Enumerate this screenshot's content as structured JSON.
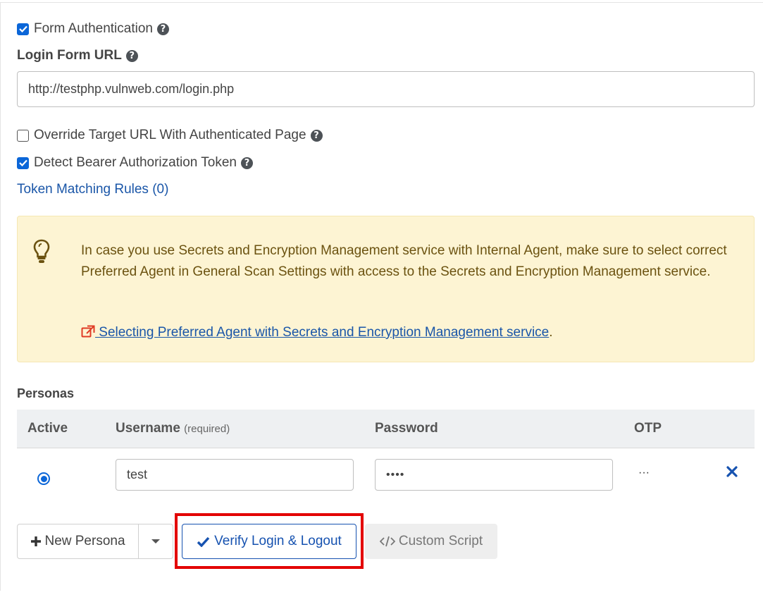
{
  "form_auth": {
    "label": "Form Authentication",
    "checked": true
  },
  "login_url": {
    "label": "Login Form URL",
    "value": "http://testphp.vulnweb.com/login.php"
  },
  "override_target": {
    "label": "Override Target URL With Authenticated Page",
    "checked": false
  },
  "detect_bearer": {
    "label": "Detect Bearer Authorization Token",
    "checked": true
  },
  "token_rules_link": "Token Matching Rules (0)",
  "alert": {
    "text": "In case you use Secrets and Encryption Management service with Internal Agent, make sure to select correct Preferred Agent in General Scan Settings with access to the Secrets and Encryption Management service.",
    "link_text": " Selecting Preferred Agent with Secrets and Encryption Management service",
    "link_suffix": "."
  },
  "personas": {
    "title": "Personas",
    "headers": {
      "active": "Active",
      "username": "Username",
      "username_note": "(required)",
      "password": "Password",
      "otp": "OTP"
    },
    "rows": [
      {
        "active": true,
        "username": "test",
        "password": "••••",
        "otp": "···"
      }
    ]
  },
  "buttons": {
    "new_persona": "New Persona",
    "verify": "Verify Login & Logout",
    "custom_script": "Custom Script"
  },
  "colors": {
    "highlight": "#e30000",
    "link": "#1a56a8",
    "alert_bg": "#fdf4d3",
    "accent": "#0b66d8"
  }
}
